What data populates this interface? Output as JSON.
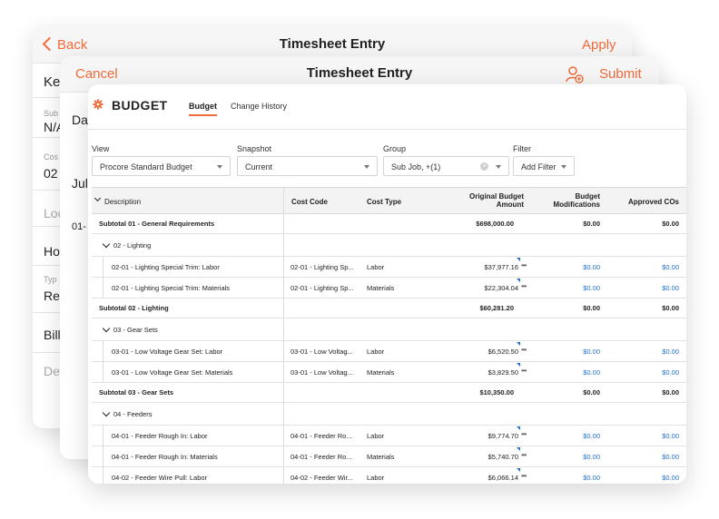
{
  "back_card": {
    "back_label": "Back",
    "title": "Timesheet Entry",
    "apply_label": "Apply",
    "rows": [
      "Kel",
      "Sub",
      "N/A",
      "Cos",
      "02",
      "Loc",
      "Ho",
      "Typ",
      "Re",
      "Bill",
      "De"
    ]
  },
  "mid_card": {
    "cancel_label": "Cancel",
    "title": "Timesheet Entry",
    "submit_label": "Submit",
    "rows": [
      "Da",
      "Jul",
      "01-"
    ]
  },
  "budget": {
    "title": "BUDGET",
    "tabs": [
      "Budget",
      "Change History"
    ],
    "filters": {
      "view_label": "View",
      "view_value": "Procore Standard Budget",
      "snapshot_label": "Snapshot",
      "snapshot_value": "Current",
      "group_label": "Group",
      "group_value": "Sub Job, +(1)",
      "filter_label": "Filter",
      "filter_value": "Add Filter"
    },
    "columns": {
      "description": "Description",
      "cost_code": "Cost Code",
      "cost_type": "Cost Type",
      "original_1": "Original Budget",
      "original_2": "Amount",
      "mods_1": "Budget",
      "mods_2": "Modifications",
      "approved": "Approved COs"
    },
    "rows": [
      {
        "kind": "subtotal",
        "desc": "Subtotal 01 - General Requirements",
        "code": "",
        "type": "",
        "amount": "$698,000.00",
        "mods": "$0.00",
        "cos": "$0.00"
      },
      {
        "kind": "group",
        "desc": "02 - Lighting"
      },
      {
        "kind": "line",
        "desc": "02-01 - Lighting Special Trim: Labor",
        "code": "02-01 - Lighting Sp...",
        "type": "Labor",
        "amount": "$37,977.16",
        "mods": "$0.00",
        "cos": "$0.00"
      },
      {
        "kind": "line",
        "desc": "02-01 - Lighting Special Trim: Materials",
        "code": "02-01 - Lighting Sp...",
        "type": "Materials",
        "amount": "$22,304.04",
        "mods": "$0.00",
        "cos": "$0.00"
      },
      {
        "kind": "subtotal",
        "desc": "Subtotal 02 - Lighting",
        "code": "",
        "type": "",
        "amount": "$60,281.20",
        "mods": "$0.00",
        "cos": "$0.00"
      },
      {
        "kind": "group",
        "desc": "03 - Gear Sets"
      },
      {
        "kind": "line",
        "desc": "03-01 - Low Voltage Gear Set: Labor",
        "code": "03-01 - Low Voltag...",
        "type": "Labor",
        "amount": "$6,520.50",
        "mods": "$0.00",
        "cos": "$0.00"
      },
      {
        "kind": "line",
        "desc": "03-01 - Low Voltage Gear Set: Materials",
        "code": "03-01 - Low Voltag...",
        "type": "Materials",
        "amount": "$3,829.50",
        "mods": "$0.00",
        "cos": "$0.00"
      },
      {
        "kind": "subtotal",
        "desc": "Subtotal 03 - Gear Sets",
        "code": "",
        "type": "",
        "amount": "$10,350.00",
        "mods": "$0.00",
        "cos": "$0.00"
      },
      {
        "kind": "group",
        "desc": "04 - Feeders"
      },
      {
        "kind": "line",
        "desc": "04-01 - Feeder Rough In: Labor",
        "code": "04-01 - Feeder Ro...",
        "type": "Labor",
        "amount": "$9,774.70",
        "mods": "$0.00",
        "cos": "$0.00"
      },
      {
        "kind": "line",
        "desc": "04-01 - Feeder Rough In: Materials",
        "code": "04-01 - Feeder Ro...",
        "type": "Materials",
        "amount": "$5,740.70",
        "mods": "$0.00",
        "cos": "$0.00"
      },
      {
        "kind": "line",
        "desc": "04-02 - Feeder Wire Pull: Labor",
        "code": "04-02 - Feeder Wir...",
        "type": "Labor",
        "amount": "$6,066.14",
        "mods": "$0.00",
        "cos": "$0.00"
      }
    ]
  },
  "colors": {
    "accent": "#f26b3a",
    "link": "#1f6fd1"
  },
  "icons": {
    "back": "chevron-left-icon",
    "user_add": "user-add-icon",
    "gear": "gear-icon",
    "caret": "caret-down-icon",
    "clear": "clear-icon",
    "more": "more-icon"
  }
}
